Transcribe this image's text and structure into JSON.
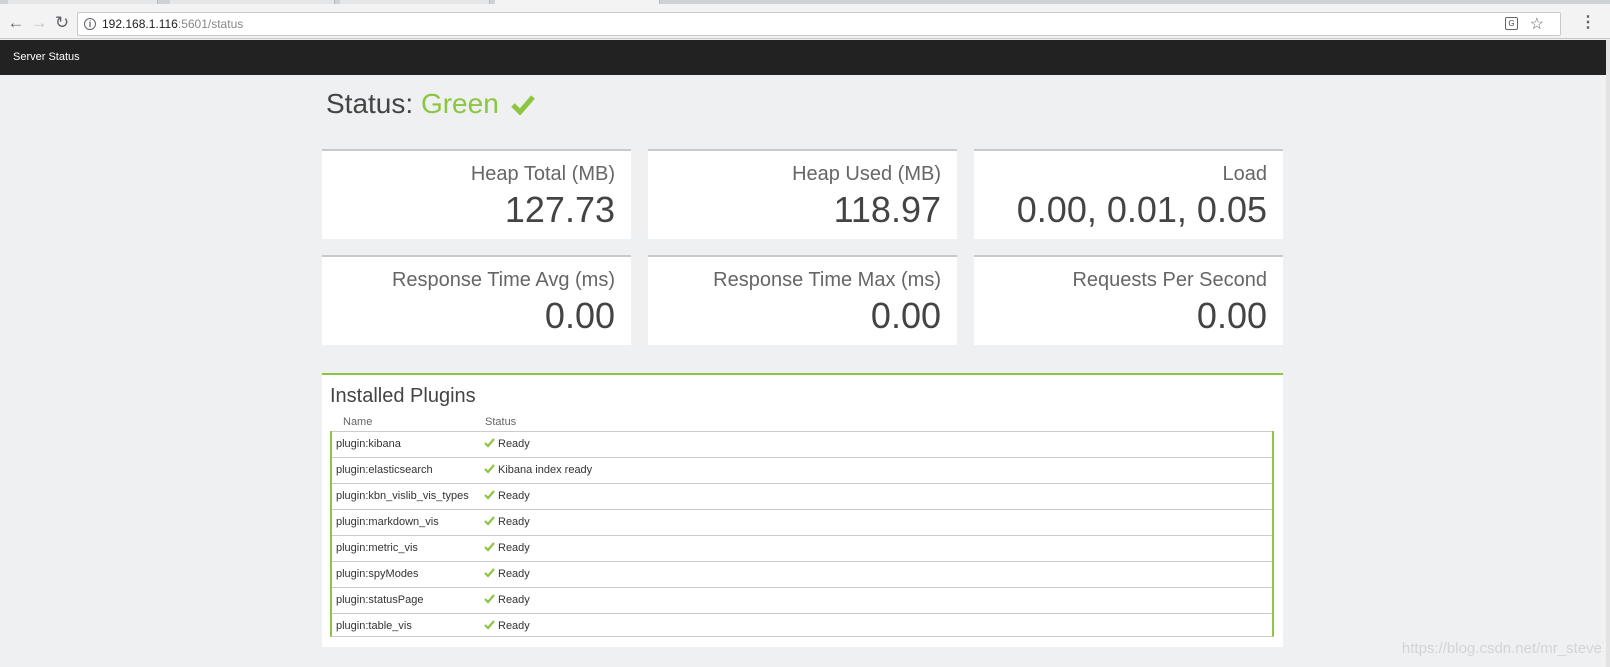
{
  "browser": {
    "url_host": "192.168.1.116",
    "url_rest": ":5601/status"
  },
  "header": {
    "title": "Server Status"
  },
  "status": {
    "label": "Status:",
    "state": "Green",
    "color": "#8cc63f"
  },
  "metrics": [
    {
      "label": "Heap Total (MB)",
      "value": "127.73"
    },
    {
      "label": "Heap Used (MB)",
      "value": "118.97"
    },
    {
      "label": "Load",
      "value": "0.00, 0.01, 0.05"
    },
    {
      "label": "Response Time Avg (ms)",
      "value": "0.00"
    },
    {
      "label": "Response Time Max (ms)",
      "value": "0.00"
    },
    {
      "label": "Requests Per Second",
      "value": "0.00"
    }
  ],
  "plugins": {
    "title": "Installed Plugins",
    "columns": [
      "Name",
      "Status"
    ],
    "rows": [
      {
        "name": "plugin:kibana",
        "status": "Ready"
      },
      {
        "name": "plugin:elasticsearch",
        "status": "Kibana index ready"
      },
      {
        "name": "plugin:kbn_vislib_vis_types",
        "status": "Ready"
      },
      {
        "name": "plugin:markdown_vis",
        "status": "Ready"
      },
      {
        "name": "plugin:metric_vis",
        "status": "Ready"
      },
      {
        "name": "plugin:spyModes",
        "status": "Ready"
      },
      {
        "name": "plugin:statusPage",
        "status": "Ready"
      },
      {
        "name": "plugin:table_vis",
        "status": "Ready"
      }
    ]
  },
  "watermark": "https://blog.csdn.net/mr_steve"
}
